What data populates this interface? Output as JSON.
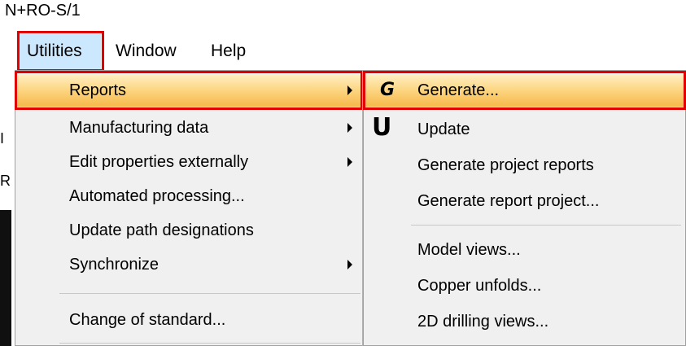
{
  "window": {
    "title": "N+RO-S/1"
  },
  "menubar": {
    "items": [
      "Utilities",
      "Window",
      "Help"
    ]
  },
  "utilities_menu": {
    "items": [
      {
        "label": "Reports"
      },
      {
        "label": "Manufacturing data"
      },
      {
        "label": "Edit properties externally"
      },
      {
        "label": "Automated processing..."
      },
      {
        "label": "Update path designations"
      },
      {
        "label": "Synchronize"
      },
      {
        "label": "Change of standard..."
      }
    ]
  },
  "reports_menu": {
    "items": [
      {
        "label": "Generate...",
        "icon": "G"
      },
      {
        "label": "Update",
        "icon": "U"
      },
      {
        "label": "Generate project reports"
      },
      {
        "label": "Generate report project..."
      },
      {
        "label": "Model views..."
      },
      {
        "label": "Copper unfolds..."
      },
      {
        "label": "2D drilling views..."
      }
    ]
  },
  "colors": {
    "highlight_border": "#e00000",
    "menu_bg": "#f0f0f0",
    "active_menu_bg": "#cce8ff"
  },
  "background_fragments": [
    "I",
    "R"
  ]
}
